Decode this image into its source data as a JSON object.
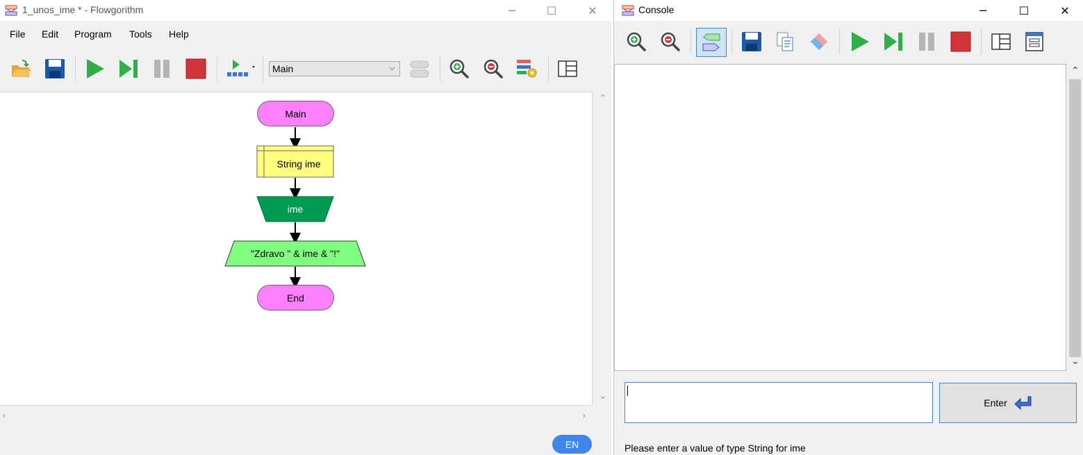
{
  "main_window": {
    "title": "1_unos_ime * - Flowgorithm",
    "menu": [
      "File",
      "Edit",
      "Program",
      "Tools",
      "Help"
    ],
    "function_select": {
      "value": "Main"
    },
    "toolbar_icons": [
      "open-icon",
      "save-icon",
      "run-icon",
      "step-icon",
      "pause-icon",
      "stop-icon",
      "run-options-icon",
      "layout-toggle-icon",
      "zoom-in-icon",
      "zoom-out-icon",
      "variables-icon",
      "panels-icon"
    ],
    "language_badge": "EN",
    "flowchart": {
      "start": "Main",
      "declare": "String ime",
      "input": "ime",
      "output": "\"Zdravo \" & ime & \"!\"",
      "end": "End"
    },
    "colors": {
      "terminal": "#ff80ff",
      "declare": "#ffff80",
      "input": "#009a50",
      "output": "#80ff80"
    }
  },
  "console_window": {
    "title": "Console",
    "toolbar_icons": [
      "zoom-in-icon",
      "zoom-out-icon",
      "chat-view-icon",
      "save-icon",
      "copy-icon",
      "erase-icon",
      "run-icon",
      "step-icon",
      "pause-icon",
      "stop-icon",
      "side-by-side-icon",
      "stacked-icon"
    ],
    "input_value": "",
    "enter_label": "Enter",
    "status": "Please enter a value of type String for ime"
  }
}
